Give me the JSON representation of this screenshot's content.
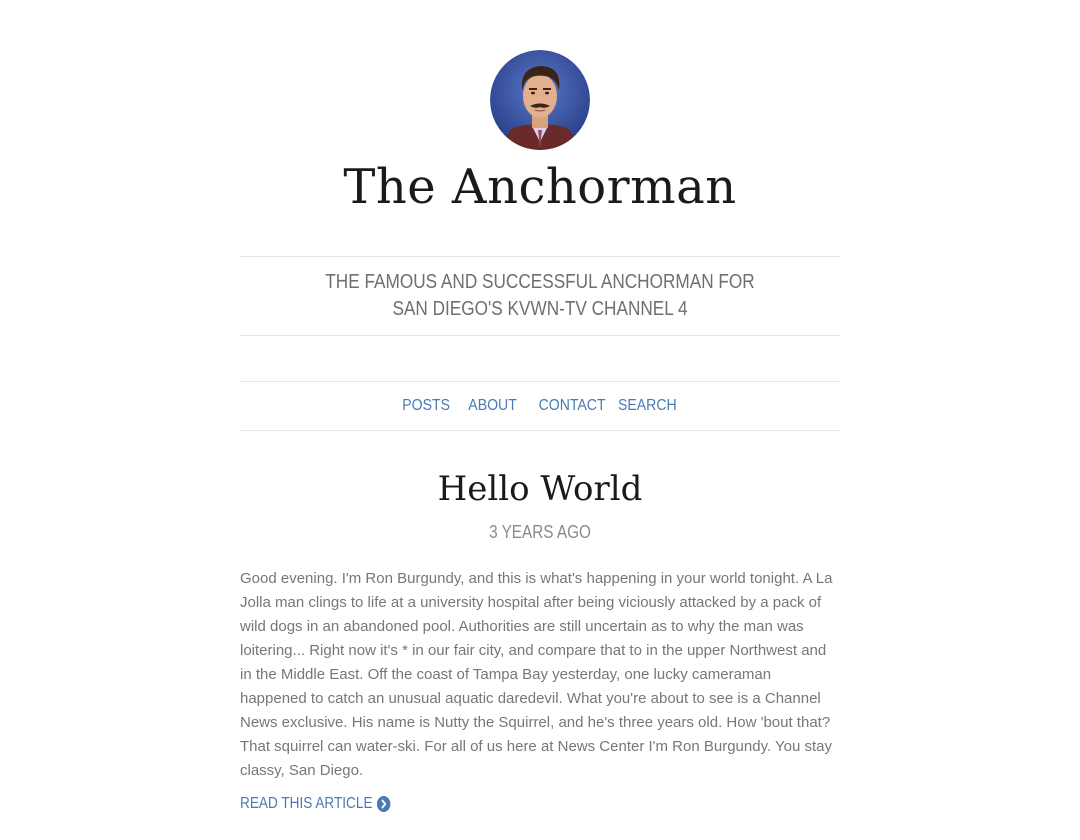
{
  "site": {
    "title": "The Anchorman",
    "tagline": "THE FAMOUS AND SUCCESSFUL ANCHORMAN FOR SAN DIEGO'S KVWN-TV CHANNEL 4",
    "avatar_icon": "avatar-portrait"
  },
  "nav": {
    "items": [
      {
        "label": "POSTS"
      },
      {
        "label": "ABOUT"
      },
      {
        "label": "CONTACT"
      },
      {
        "label": "SEARCH"
      }
    ]
  },
  "post": {
    "title": "Hello World",
    "date": "3 YEARS AGO",
    "body": "Good evening. I'm Ron Burgundy, and this is what's happening in your world tonight. A La Jolla man clings to life at a university hospital after being viciously attacked by a pack of wild dogs in an abandoned pool. Authorities are still uncertain as to why the man was loitering... Right now it's * in our fair city, and compare that to in the upper Northwest and in the Middle East. Off the coast of Tampa Bay yesterday, one lucky cameraman happened to catch an unusual aquatic daredevil. What you're about to see is a Channel News exclusive. His name is Nutty the Squirrel, and he's three years old. How 'bout that? That squirrel can water-ski. For all of us here at News Center I'm Ron Burgundy. You stay classy, San Diego.",
    "read_more": "READ THIS ARTICLE",
    "read_more_icon": "chevron-circle-right-icon"
  },
  "colors": {
    "link": "#4a7ab5",
    "title_text": "#1a1a1a",
    "body_text": "#777777",
    "rule": "#e5e5e5"
  }
}
